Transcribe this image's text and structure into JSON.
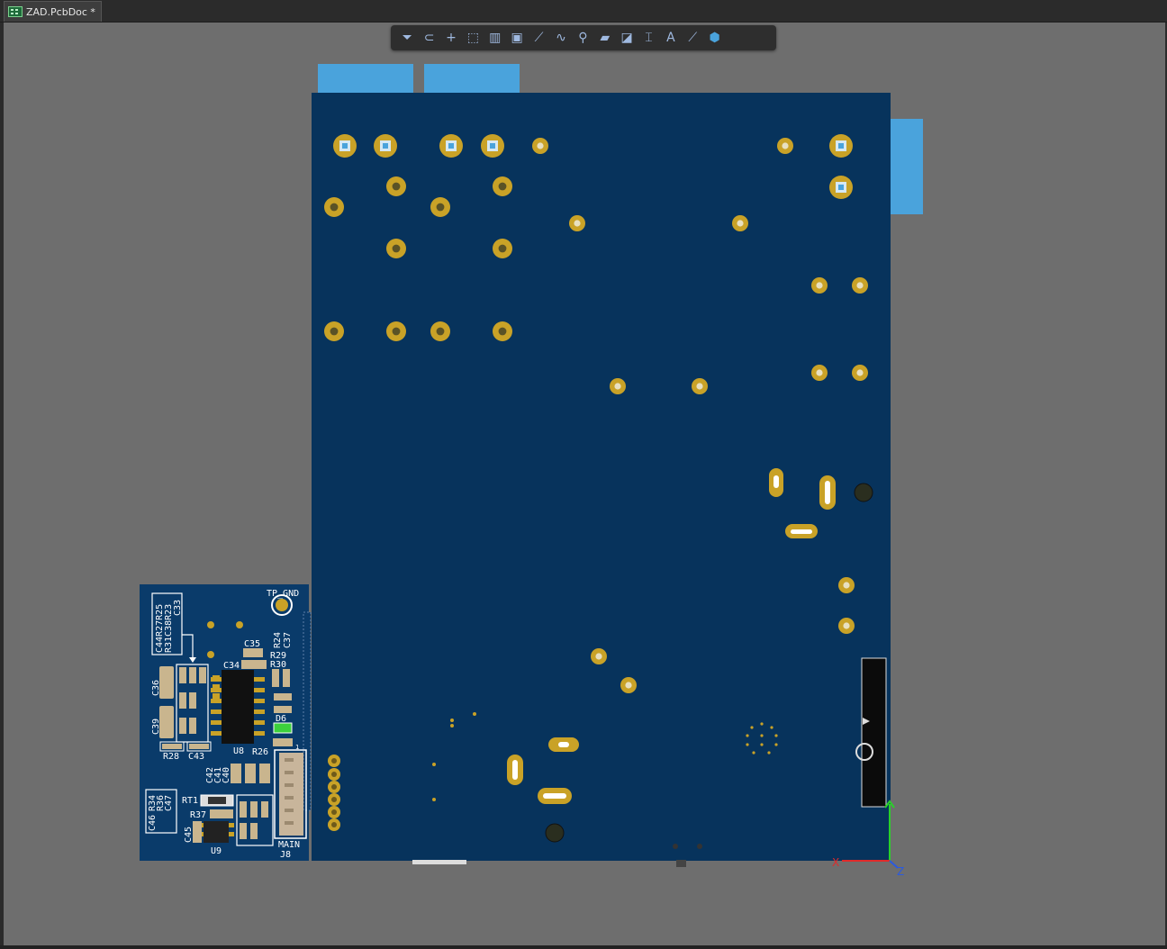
{
  "tab": {
    "title": "ZAD.PcbDoc *"
  },
  "toolbar": {
    "tools": [
      {
        "name": "filter-icon",
        "glyph": "⏷"
      },
      {
        "name": "magnet-icon",
        "glyph": "⊂"
      },
      {
        "name": "crosshair-icon",
        "glyph": "+"
      },
      {
        "name": "select-rect-icon",
        "glyph": "⬚"
      },
      {
        "name": "align-icon",
        "glyph": "▥"
      },
      {
        "name": "component-icon",
        "glyph": "▣"
      },
      {
        "name": "route-icon",
        "glyph": "⟋"
      },
      {
        "name": "interactive-route-icon",
        "glyph": "∿"
      },
      {
        "name": "pad-via-icon",
        "glyph": "⚲"
      },
      {
        "name": "polygon-icon",
        "glyph": "▰"
      },
      {
        "name": "graph-icon",
        "glyph": "◪"
      },
      {
        "name": "dimension-icon",
        "glyph": "⌶"
      },
      {
        "name": "text-icon",
        "glyph": "A"
      },
      {
        "name": "line-icon",
        "glyph": "⟋"
      },
      {
        "name": "3d-icon",
        "glyph": "⬢"
      }
    ]
  },
  "silkscreen": {
    "tp_gnd": "TP_GND",
    "refs_left_box": "C44R27R25",
    "refs_left_box2": "R31C38R23",
    "refs_left_box3": "C33",
    "c36": "C36",
    "c39": "C39",
    "r28": "R28",
    "c43": "C43",
    "c35": "C35",
    "c34": "C34",
    "r24": "R24",
    "c37": "C37",
    "r29": "R29",
    "r30": "R30",
    "d6": "D6",
    "u8": "U8",
    "r26": "R26",
    "c42": "C42",
    "c41": "C41",
    "c40": "C40",
    "rt1": "RT1",
    "r37": "R37",
    "c45": "C45",
    "u9": "U9",
    "box2_a": "R34",
    "box2_b": "R36",
    "box2_c": "C47",
    "box2_d": "C46",
    "main": "MAIN",
    "j8": "J8",
    "pin1": "1"
  },
  "colors": {
    "board": "#07335c",
    "board_small": "#0a3b6a",
    "pad_gold": "#c9a227",
    "copper_blue": "#4aa3dc",
    "workspace": "#6e6e6e"
  },
  "axes": {
    "x_label": "X",
    "y_label": "Y",
    "z_label": "Z"
  }
}
